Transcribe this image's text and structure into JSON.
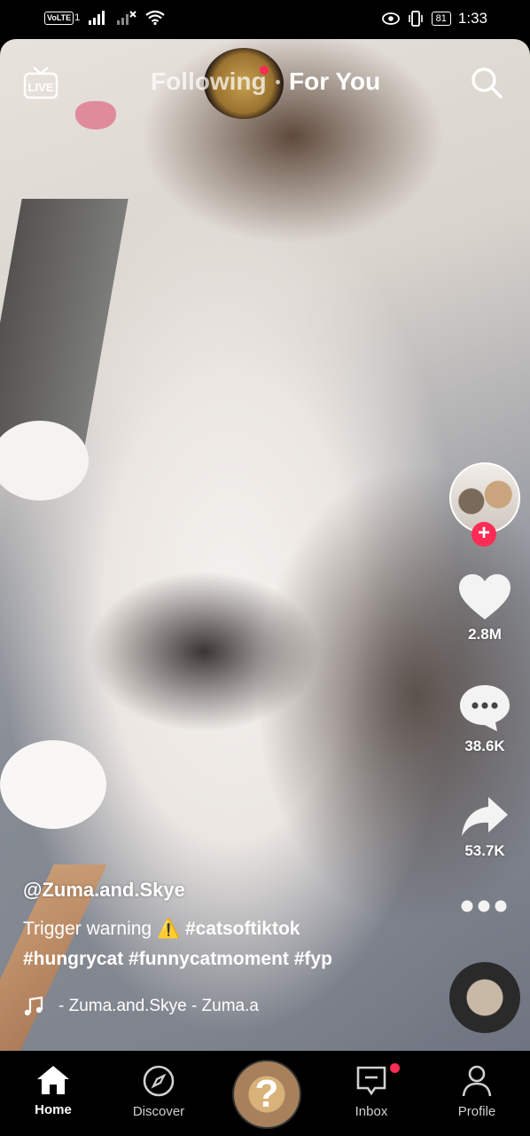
{
  "status_bar": {
    "volte": "VoLTE",
    "sim": "1",
    "battery": "81",
    "time": "1:33"
  },
  "top_nav": {
    "live": "LIVE",
    "following": "Following",
    "for_you": "For You"
  },
  "rail": {
    "likes": "2.8M",
    "comments": "38.6K",
    "shares": "53.7K"
  },
  "caption": {
    "username": "@Zuma.and.Skye",
    "line1_text": "Trigger warning ⚠️",
    "tag1": "#catsoftiktok",
    "line2": "#hungrycat #funnycatmoment #fyp",
    "sound": "- Zuma.and.Skye - Zuma.a"
  },
  "bottom_nav": {
    "home": "Home",
    "discover": "Discover",
    "inbox": "Inbox",
    "profile": "Profile",
    "create": "?"
  },
  "colors": {
    "accent": "#fe2c55",
    "background": "#000000"
  }
}
